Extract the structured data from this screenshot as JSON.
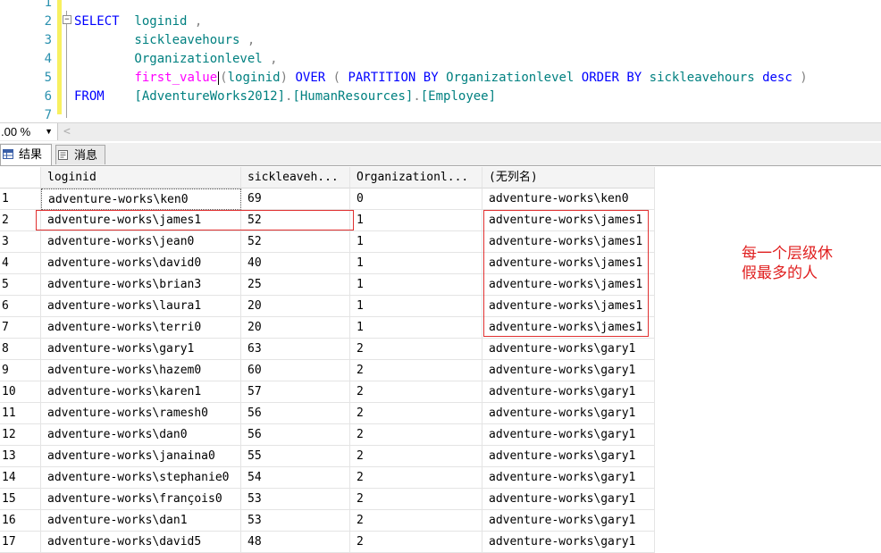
{
  "editor": {
    "line_numbers": [
      "1",
      "2",
      "3",
      "4",
      "5",
      "6",
      "7"
    ],
    "lines": [
      [],
      [
        {
          "t": "SELECT",
          "c": "kw"
        },
        {
          "t": "  loginid ",
          "c": "id"
        },
        {
          "t": ",",
          "c": "op"
        }
      ],
      [
        {
          "t": "        sickleavehours ",
          "c": "id"
        },
        {
          "t": ",",
          "c": "op"
        }
      ],
      [
        {
          "t": "        Organizationlevel ",
          "c": "id"
        },
        {
          "t": ",",
          "c": "op"
        }
      ],
      [
        {
          "t": "        ",
          "c": ""
        },
        {
          "t": "first_value",
          "c": "fn"
        },
        {
          "t": "",
          "c": "caret"
        },
        {
          "t": "(",
          "c": "op"
        },
        {
          "t": "loginid",
          "c": "id"
        },
        {
          "t": ")",
          "c": "op"
        },
        {
          "t": " OVER ",
          "c": "kw"
        },
        {
          "t": "( ",
          "c": "op"
        },
        {
          "t": "PARTITION BY ",
          "c": "kw"
        },
        {
          "t": "Organizationlevel ",
          "c": "id"
        },
        {
          "t": "ORDER BY ",
          "c": "kw"
        },
        {
          "t": "sickleavehours ",
          "c": "id"
        },
        {
          "t": "desc ",
          "c": "kw"
        },
        {
          "t": ")",
          "c": "op"
        }
      ],
      [
        {
          "t": "FROM",
          "c": "kw"
        },
        {
          "t": "    ",
          "c": ""
        },
        {
          "t": "[AdventureWorks2012]",
          "c": "id"
        },
        {
          "t": ".",
          "c": "op"
        },
        {
          "t": "[HumanResources]",
          "c": "id"
        },
        {
          "t": ".",
          "c": "op"
        },
        {
          "t": "[Employee]",
          "c": "id"
        }
      ],
      []
    ]
  },
  "zoom": {
    "value": ".00 %",
    "arrow": "▼",
    "scroll_left": "<"
  },
  "tabs": [
    {
      "label": "结果",
      "icon": "grid-icon",
      "active": true
    },
    {
      "label": "消息",
      "icon": "message-icon",
      "active": false
    }
  ],
  "grid": {
    "columns": [
      "loginid",
      "sickleaveh...",
      "Organizationl...",
      "(无列名)"
    ],
    "rows": [
      [
        "1",
        "adventure-works\\ken0",
        "69",
        "0",
        "adventure-works\\ken0"
      ],
      [
        "2",
        "adventure-works\\james1",
        "52",
        "1",
        "adventure-works\\james1"
      ],
      [
        "3",
        "adventure-works\\jean0",
        "52",
        "1",
        "adventure-works\\james1"
      ],
      [
        "4",
        "adventure-works\\david0",
        "40",
        "1",
        "adventure-works\\james1"
      ],
      [
        "5",
        "adventure-works\\brian3",
        "25",
        "1",
        "adventure-works\\james1"
      ],
      [
        "6",
        "adventure-works\\laura1",
        "20",
        "1",
        "adventure-works\\james1"
      ],
      [
        "7",
        "adventure-works\\terri0",
        "20",
        "1",
        "adventure-works\\james1"
      ],
      [
        "8",
        "adventure-works\\gary1",
        "63",
        "2",
        "adventure-works\\gary1"
      ],
      [
        "9",
        "adventure-works\\hazem0",
        "60",
        "2",
        "adventure-works\\gary1"
      ],
      [
        "10",
        "adventure-works\\karen1",
        "57",
        "2",
        "adventure-works\\gary1"
      ],
      [
        "11",
        "adventure-works\\ramesh0",
        "56",
        "2",
        "adventure-works\\gary1"
      ],
      [
        "12",
        "adventure-works\\dan0",
        "56",
        "2",
        "adventure-works\\gary1"
      ],
      [
        "13",
        "adventure-works\\janaina0",
        "55",
        "2",
        "adventure-works\\gary1"
      ],
      [
        "14",
        "adventure-works\\stephanie0",
        "54",
        "2",
        "adventure-works\\gary1"
      ],
      [
        "15",
        "adventure-works\\françois0",
        "53",
        "2",
        "adventure-works\\gary1"
      ],
      [
        "16",
        "adventure-works\\dan1",
        "53",
        "2",
        "adventure-works\\gary1"
      ],
      [
        "17",
        "adventure-works\\david5",
        "48",
        "2",
        "adventure-works\\gary1"
      ]
    ]
  },
  "annotation": {
    "text": "每一个层级休假最多的人",
    "color": "#e02020"
  },
  "colors": {
    "keyword": "#0000ff",
    "identifier": "#008080",
    "function": "#ff00ff",
    "operator": "#808080",
    "line_number": "#2b91af",
    "annotation_box": "#e03030"
  }
}
